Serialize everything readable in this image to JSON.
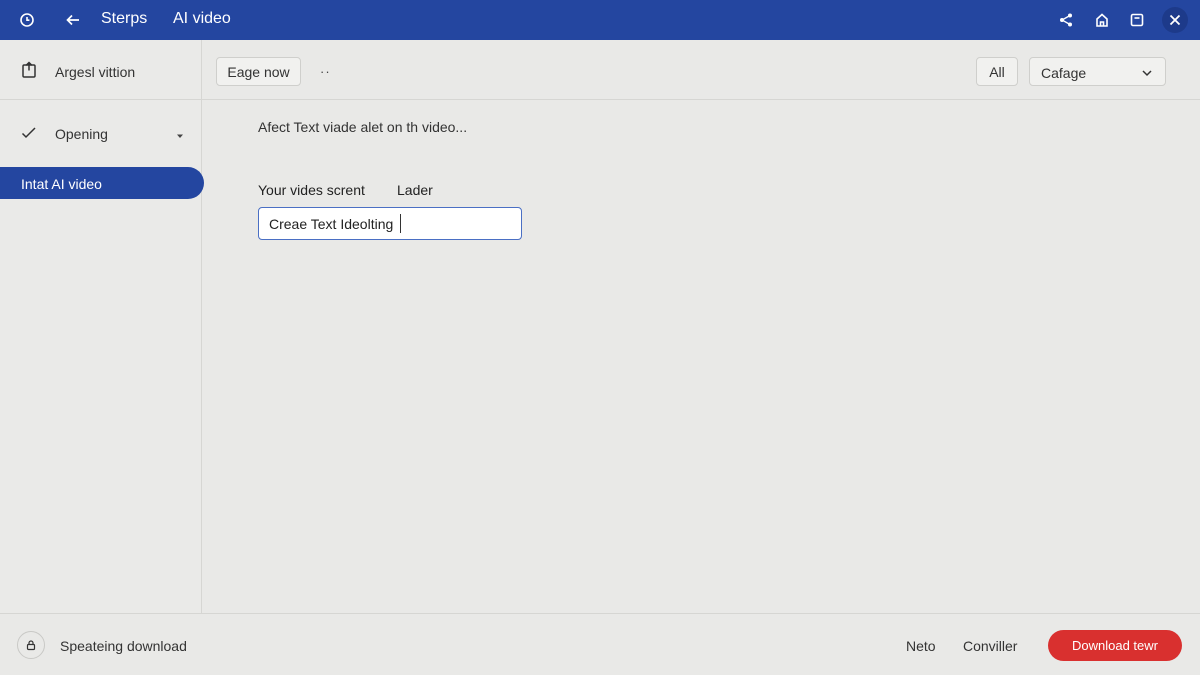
{
  "titlebar": {
    "crumb": "Sterps",
    "title": "AI video",
    "accent": "#2446a0",
    "icons": [
      "clock-icon",
      "back-arrow-icon",
      "share-icon",
      "home-icon",
      "window-icon",
      "close-icon"
    ]
  },
  "sidebar": {
    "header_label": "Argesl vittion",
    "items": [
      {
        "label": "Opening",
        "icon": "check-icon",
        "expandable": true
      },
      {
        "label": "Intat AI video",
        "active": true
      }
    ]
  },
  "toolbar": {
    "page_button": "Eage now",
    "more_label": "··",
    "all_button": "All",
    "select_value": "Cafage"
  },
  "main": {
    "hint": "Afect Text viade alet on th video...",
    "field_label": "Your vides scrent",
    "field_label_secondary": "Lader",
    "input_value": "Creae Text Ideolting"
  },
  "footer": {
    "status": "Speateing download",
    "next_label": "Neto",
    "cancel_label": "Conviller",
    "download_label": "Download tewr",
    "download_color": "#d9302f"
  }
}
